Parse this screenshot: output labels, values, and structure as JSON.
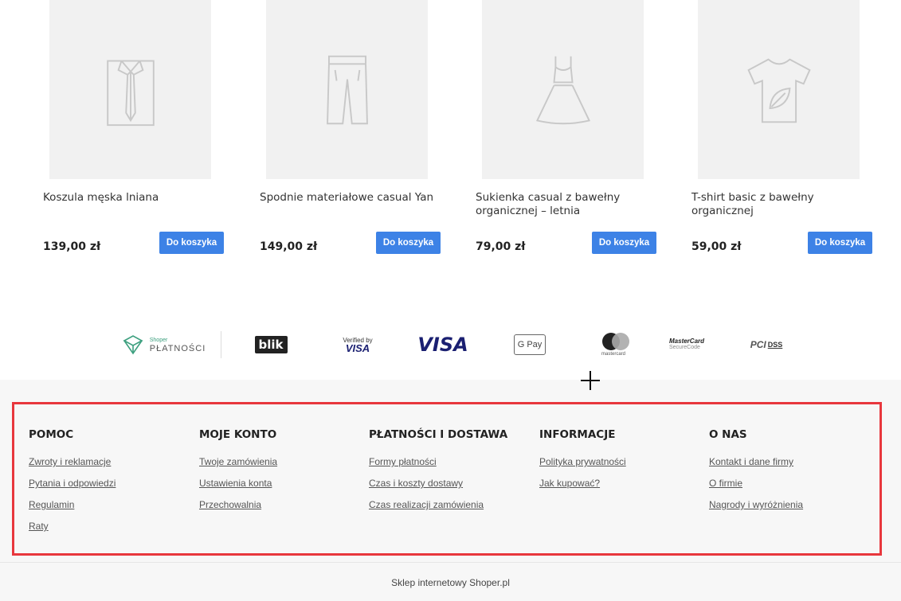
{
  "products": [
    {
      "icon": "shirt-icon",
      "name": "Koszula męska lniana",
      "price": "139,00 zł",
      "button": "Do koszyka"
    },
    {
      "icon": "trousers-icon",
      "name": "Spodnie materiałowe casual Yan",
      "price": "149,00 zł",
      "button": "Do koszyka"
    },
    {
      "icon": "dress-icon",
      "name": "Sukienka casual z bawełny organicznej – letnia",
      "price": "79,00 zł",
      "button": "Do koszyka"
    },
    {
      "icon": "tshirt-leaf-icon",
      "name": "T-shirt basic z bawełny organicznej",
      "price": "59,00 zł",
      "button": "Do koszyka"
    }
  ],
  "payments": {
    "shoper": {
      "small": "Shoper",
      "big": "PŁATNOŚCI"
    },
    "blik": "blik",
    "verified_visa": {
      "top": "Verified by",
      "bottom": "VISA"
    },
    "visa": "VISA",
    "gpay": "G Pay",
    "mastercard": "mastercard",
    "mc_securecode": {
      "top": "MasterCard",
      "bottom": "SecureCode"
    },
    "pci": {
      "pci": "PCI",
      "dss": "DSS"
    }
  },
  "footer": {
    "columns": [
      {
        "title": "POMOC",
        "links": [
          "Zwroty i reklamacje",
          "Pytania i odpowiedzi",
          "Regulamin",
          "Raty"
        ]
      },
      {
        "title": "MOJE KONTO",
        "links": [
          "Twoje zamówienia",
          "Ustawienia konta",
          "Przechowalnia"
        ]
      },
      {
        "title": "PŁATNOŚCI I DOSTAWA",
        "links": [
          "Formy płatności",
          "Czas i koszty dostawy",
          "Czas realizacji zamówienia"
        ]
      },
      {
        "title": "INFORMACJE",
        "links": [
          "Polityka prywatności",
          "Jak kupować?"
        ]
      },
      {
        "title": "O NAS",
        "links": [
          "Kontakt i dane firmy",
          "O firmie",
          "Nagrody i wyróżnienia"
        ]
      }
    ],
    "credit": "Sklep internetowy Shoper.pl"
  },
  "colors": {
    "button": "#3d82e6",
    "highlight": "#e8373d",
    "footer_bg": "#f7f7f7"
  }
}
